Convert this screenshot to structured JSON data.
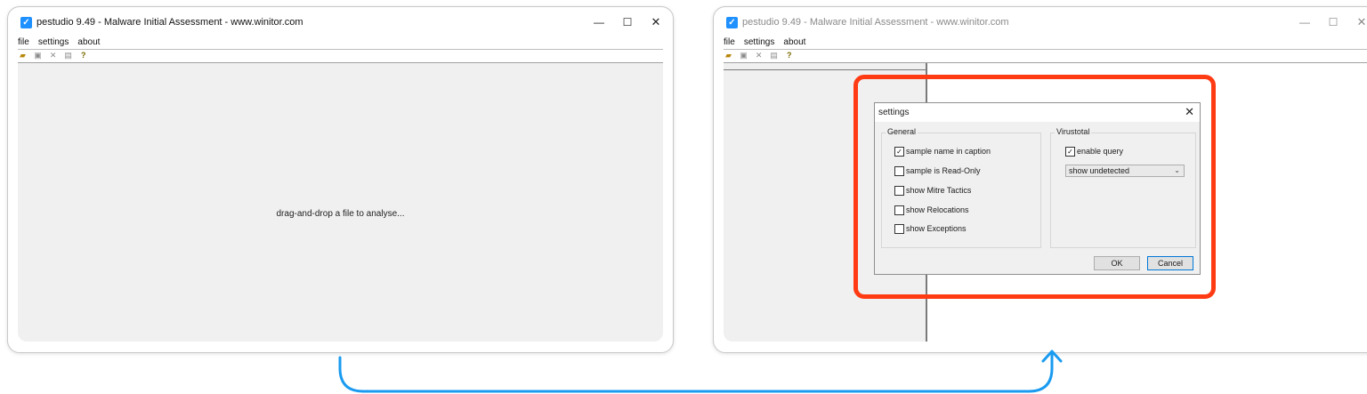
{
  "window": {
    "title": "pestudio 9.49 - Malware Initial Assessment - www.winitor.com",
    "minimize": "—",
    "maximize": "☐",
    "close": "✕",
    "app_icon": "✓"
  },
  "menu": [
    "file",
    "settings",
    "about"
  ],
  "toolbar": {
    "icons": [
      "open-folder-icon",
      "save-icon",
      "close-file-icon",
      "list-icon",
      "help-icon"
    ],
    "glyphs": [
      "▰",
      "▣",
      "✕",
      "▤",
      "?"
    ]
  },
  "left_panel": {
    "drop_text": "drag-and-drop a file to analyse..."
  },
  "settings_dialog": {
    "title": "settings",
    "close": "✕",
    "general": {
      "legend": "General",
      "options": [
        {
          "label": "sample name in caption",
          "checked": true
        },
        {
          "label": "sample is Read-Only",
          "checked": false
        },
        {
          "label": "show Mitre Tactics",
          "checked": false
        },
        {
          "label": "show Relocations",
          "checked": false
        },
        {
          "label": "show Exceptions",
          "checked": false
        }
      ]
    },
    "virustotal": {
      "legend": "Virustotal",
      "enable_query": {
        "label": "enable query",
        "checked": true
      },
      "dropdown_value": "show undetected"
    },
    "ok_label": "OK",
    "cancel_label": "Cancel"
  },
  "colors": {
    "highlight": "#ff3b14",
    "arrow": "#1a9bf0",
    "app_icon": "#1e90ff"
  }
}
